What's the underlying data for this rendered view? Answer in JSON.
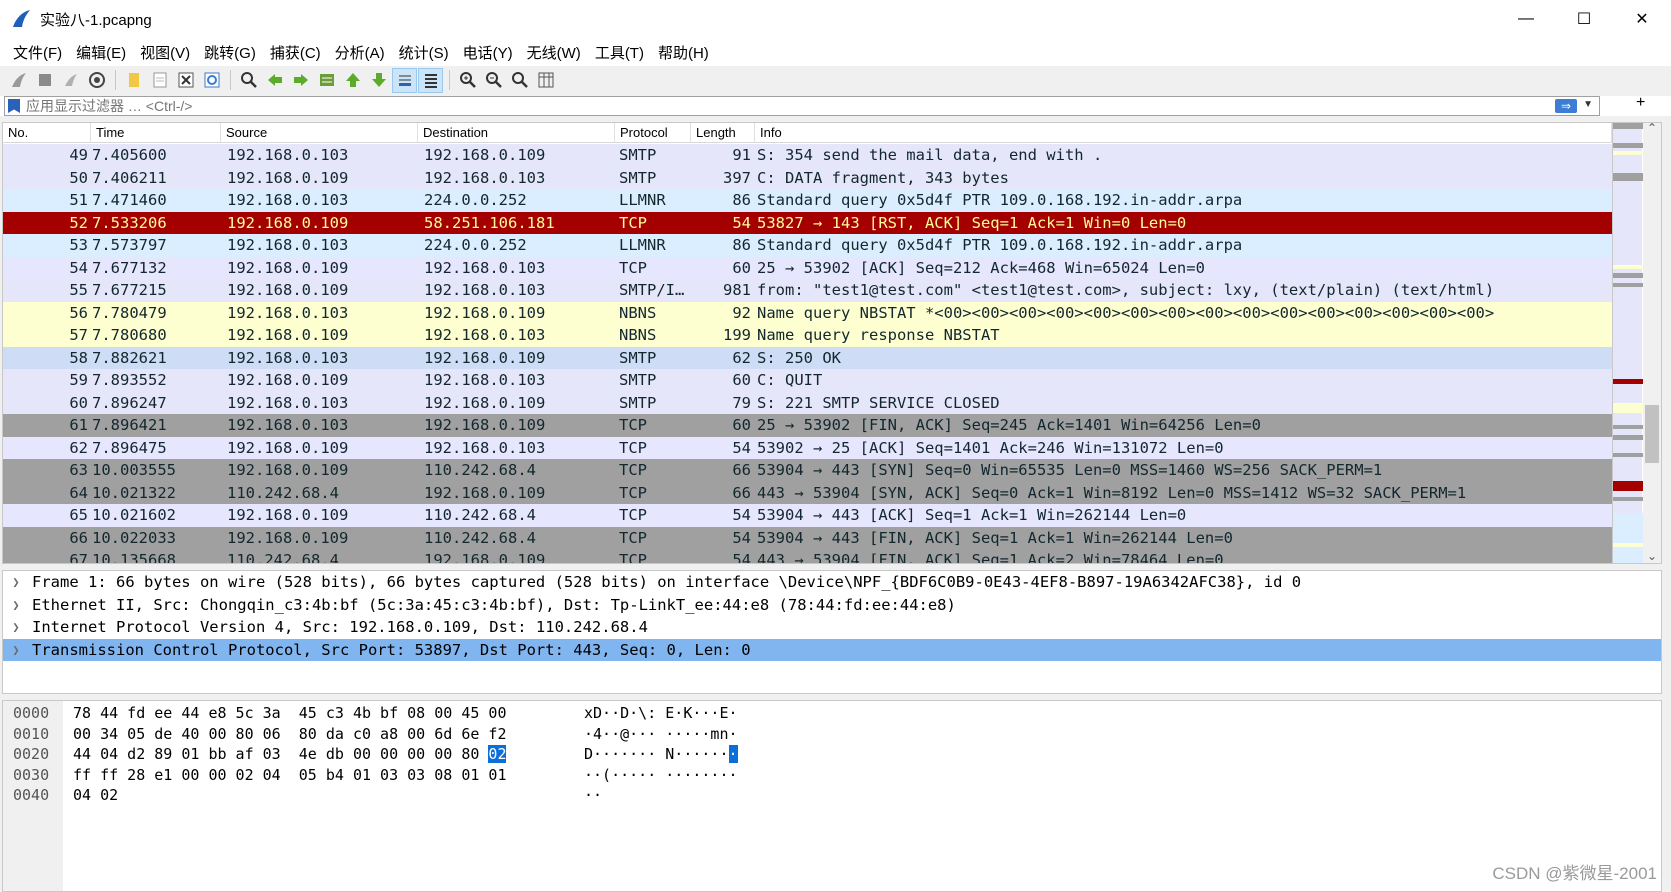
{
  "window": {
    "title": "实验八-1.pcapng",
    "minimize": "—",
    "maximize": "☐",
    "close": "✕"
  },
  "menu": [
    "文件(F)",
    "编辑(E)",
    "视图(V)",
    "跳转(G)",
    "捕获(C)",
    "分析(A)",
    "统计(S)",
    "电话(Y)",
    "无线(W)",
    "工具(T)",
    "帮助(H)"
  ],
  "toolbar": {
    "icons": [
      "shark-fin-start-icon",
      "stop-icon",
      "restart-icon",
      "options-gear-icon",
      "open-folder-icon",
      "save-file-icon",
      "close-file-icon",
      "reload-icon",
      "find-icon",
      "back-arrow-icon",
      "forward-arrow-icon",
      "go-to-packet-icon",
      "first-packet-icon",
      "last-packet-icon",
      "autoscroll-icon",
      "colorize-icon",
      "zoom-in-icon",
      "zoom-out-icon",
      "zoom-normal-icon",
      "resize-columns-icon"
    ]
  },
  "filter": {
    "placeholder": "应用显示过滤器 … <Ctrl-/>"
  },
  "packet_list": {
    "columns": [
      "No.",
      "Time",
      "Source",
      "Destination",
      "Protocol",
      "Length",
      "Info"
    ],
    "rows": [
      {
        "no": "49",
        "time": "7.405600",
        "src": "192.168.0.103",
        "dst": "192.168.0.109",
        "proto": "SMTP",
        "len": "91",
        "info": "S: 354 send the mail data, end with .",
        "bg": "#e6e6fa",
        "fg": "#12272e"
      },
      {
        "no": "50",
        "time": "7.406211",
        "src": "192.168.0.109",
        "dst": "192.168.0.103",
        "proto": "SMTP",
        "len": "397",
        "info": "C: DATA fragment, 343 bytes",
        "bg": "#e6e6fa",
        "fg": "#12272e"
      },
      {
        "no": "51",
        "time": "7.471460",
        "src": "192.168.0.103",
        "dst": "224.0.0.252",
        "proto": "LLMNR",
        "len": "86",
        "info": "Standard query 0x5d4f PTR 109.0.168.192.in-addr.arpa",
        "bg": "#daeeff",
        "fg": "#12272e"
      },
      {
        "no": "52",
        "time": "7.533206",
        "src": "192.168.0.109",
        "dst": "58.251.106.181",
        "proto": "TCP",
        "len": "54",
        "info": "53827 → 143 [RST, ACK] Seq=1 Ack=1 Win=0 Len=0",
        "bg": "#a40000",
        "fg": "#fffc9c"
      },
      {
        "no": "53",
        "time": "7.573797",
        "src": "192.168.0.103",
        "dst": "224.0.0.252",
        "proto": "LLMNR",
        "len": "86",
        "info": "Standard query 0x5d4f PTR 109.0.168.192.in-addr.arpa",
        "bg": "#daeeff",
        "fg": "#12272e"
      },
      {
        "no": "54",
        "time": "7.677132",
        "src": "192.168.0.109",
        "dst": "192.168.0.103",
        "proto": "TCP",
        "len": "60",
        "info": "25 → 53902 [ACK] Seq=212 Ack=468 Win=65024 Len=0",
        "bg": "#e7e6ff",
        "fg": "#12272e"
      },
      {
        "no": "55",
        "time": "7.677215",
        "src": "192.168.0.109",
        "dst": "192.168.0.103",
        "proto": "SMTP/I…",
        "len": "981",
        "info": "from: \"test1@test.com\" <test1@test.com>, subject: lxy,  (text/plain) (text/html)",
        "bg": "#e6e6fa",
        "fg": "#12272e"
      },
      {
        "no": "56",
        "time": "7.780479",
        "src": "192.168.0.103",
        "dst": "192.168.0.109",
        "proto": "NBNS",
        "len": "92",
        "info": "Name query NBSTAT *<00><00><00><00><00><00><00><00><00><00><00><00><00><00><00>",
        "bg": "#feffd0",
        "fg": "#12272e"
      },
      {
        "no": "57",
        "time": "7.780680",
        "src": "192.168.0.109",
        "dst": "192.168.0.103",
        "proto": "NBNS",
        "len": "199",
        "info": "Name query response NBSTAT",
        "bg": "#feffd0",
        "fg": "#12272e"
      },
      {
        "no": "58",
        "time": "7.882621",
        "src": "192.168.0.103",
        "dst": "192.168.0.109",
        "proto": "SMTP",
        "len": "62",
        "info": "S: 250 OK",
        "bg": "#cfdcf5",
        "fg": "#12272e"
      },
      {
        "no": "59",
        "time": "7.893552",
        "src": "192.168.0.109",
        "dst": "192.168.0.103",
        "proto": "SMTP",
        "len": "60",
        "info": "C: QUIT",
        "bg": "#e6e6fa",
        "fg": "#12272e"
      },
      {
        "no": "60",
        "time": "7.896247",
        "src": "192.168.0.103",
        "dst": "192.168.0.109",
        "proto": "SMTP",
        "len": "79",
        "info": "S: 221 SMTP SERVICE CLOSED",
        "bg": "#e6e6fa",
        "fg": "#12272e"
      },
      {
        "no": "61",
        "time": "7.896421",
        "src": "192.168.0.103",
        "dst": "192.168.0.109",
        "proto": "TCP",
        "len": "60",
        "info": "25 → 53902 [FIN, ACK] Seq=245 Ack=1401 Win=64256 Len=0",
        "bg": "#a0a0a0",
        "fg": "#12272e"
      },
      {
        "no": "62",
        "time": "7.896475",
        "src": "192.168.0.109",
        "dst": "192.168.0.103",
        "proto": "TCP",
        "len": "54",
        "info": "53902 → 25 [ACK] Seq=1401 Ack=246 Win=131072 Len=0",
        "bg": "#e7e6ff",
        "fg": "#12272e"
      },
      {
        "no": "63",
        "time": "10.003555",
        "src": "192.168.0.109",
        "dst": "110.242.68.4",
        "proto": "TCP",
        "len": "66",
        "info": "53904 → 443 [SYN] Seq=0 Win=65535 Len=0 MSS=1460 WS=256 SACK_PERM=1",
        "bg": "#a0a0a0",
        "fg": "#12272e"
      },
      {
        "no": "64",
        "time": "10.021322",
        "src": "110.242.68.4",
        "dst": "192.168.0.109",
        "proto": "TCP",
        "len": "66",
        "info": "443 → 53904 [SYN, ACK] Seq=0 Ack=1 Win=8192 Len=0 MSS=1412 WS=32 SACK_PERM=1",
        "bg": "#a0a0a0",
        "fg": "#12272e"
      },
      {
        "no": "65",
        "time": "10.021602",
        "src": "192.168.0.109",
        "dst": "110.242.68.4",
        "proto": "TCP",
        "len": "54",
        "info": "53904 → 443 [ACK] Seq=1 Ack=1 Win=262144 Len=0",
        "bg": "#e7e6ff",
        "fg": "#12272e"
      },
      {
        "no": "66",
        "time": "10.022033",
        "src": "192.168.0.109",
        "dst": "110.242.68.4",
        "proto": "TCP",
        "len": "54",
        "info": "53904 → 443 [FIN, ACK] Seq=1 Ack=1 Win=262144 Len=0",
        "bg": "#a0a0a0",
        "fg": "#12272e"
      },
      {
        "no": "67",
        "time": "10.135668",
        "src": "110.242.68.4",
        "dst": "192.168.0.109",
        "proto": "TCP",
        "len": "54",
        "info": "443 → 53904 [FIN, ACK] Seq=1 Ack=2 Win=78464 Len=0",
        "bg": "#a0a0a0",
        "fg": "#12272e"
      }
    ]
  },
  "details": [
    {
      "text": "Frame 1: 66 bytes on wire (528 bits), 66 bytes captured (528 bits) on interface \\Device\\NPF_{BDF6C0B9-0E43-4EF8-B897-19A6342AFC38}, id 0",
      "selected": false
    },
    {
      "text": "Ethernet II, Src: Chongqin_c3:4b:bf (5c:3a:45:c3:4b:bf), Dst: Tp-LinkT_ee:44:e8 (78:44:fd:ee:44:e8)",
      "selected": false
    },
    {
      "text": "Internet Protocol Version 4, Src: 192.168.0.109, Dst: 110.242.68.4",
      "selected": false
    },
    {
      "text": "Transmission Control Protocol, Src Port: 53897, Dst Port: 443, Seq: 0, Len: 0",
      "selected": true
    }
  ],
  "bytes": [
    {
      "offset": "0000",
      "hex_pre": "78 44 fd ee 44 e8 5c 3a  45 c3 4b bf 08 00 45 00",
      "hex_hl": "",
      "ascii_pre": "xD··D·\\: E·K···E·",
      "ascii_hl": ""
    },
    {
      "offset": "0010",
      "hex_pre": "00 34 05 de 40 00 80 06  80 da c0 a8 00 6d 6e f2",
      "hex_hl": "",
      "ascii_pre": "·4··@··· ·····mn·",
      "ascii_hl": ""
    },
    {
      "offset": "0020",
      "hex_pre": "44 04 d2 89 01 bb af 03  4e db 00 00 00 00 80 ",
      "hex_hl": "02",
      "ascii_pre": "D······· N······",
      "ascii_hl": "·"
    },
    {
      "offset": "0030",
      "hex_pre": "ff ff 28 e1 00 00 02 04  05 b4 01 03 03 08 01 01",
      "hex_hl": "",
      "ascii_pre": "··(····· ········",
      "ascii_hl": ""
    },
    {
      "offset": "0040",
      "hex_pre": "04 02",
      "hex_hl": "",
      "ascii_pre": "··",
      "ascii_hl": ""
    }
  ],
  "watermark": "CSDN @紫微星-2001"
}
